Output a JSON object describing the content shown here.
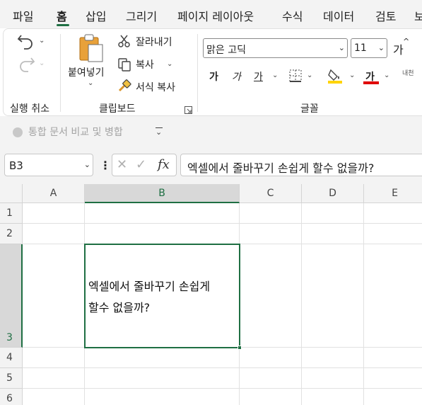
{
  "menu": {
    "tabs": [
      "파일",
      "홈",
      "삽입",
      "그리기",
      "페이지 레이아웃",
      "수식",
      "데이터",
      "검토",
      "보"
    ],
    "active_index": 1
  },
  "ribbon": {
    "undo_group_label": "실행 취소",
    "clipboard": {
      "paste_label": "붙여넣기",
      "cut_label": "잘라내기",
      "copy_label": "복사",
      "format_painter_label": "서식 복사",
      "group_label": "클립보드"
    },
    "font": {
      "name": "맑은 고딕",
      "size": "11",
      "grow_label": "가",
      "bold_label": "가",
      "italic_label": "가",
      "underline_label": "가",
      "font_color_label": "가",
      "group_label": "글꼴",
      "wrap_label": "내천"
    },
    "compare_merge_label": "통합 문서 비교 및 병합"
  },
  "formula_bar": {
    "name_box": "B3",
    "fx_label": "fx",
    "content": "엑셀에서 줄바꾸기 손쉽게 할수 없을까?"
  },
  "grid": {
    "columns": [
      "A",
      "B",
      "C",
      "D",
      "E"
    ],
    "rows": [
      "1",
      "2",
      "3",
      "4",
      "5",
      "6"
    ],
    "selected_column": "B",
    "selected_row": "3",
    "cell_b3_line1": "엑셀에서 줄바꾸기 손쉽게",
    "cell_b3_line2": "할수 없을까?"
  },
  "colors": {
    "accent": "#1f6f43",
    "highlight": "#ffd400",
    "font_color": "#e00000"
  }
}
